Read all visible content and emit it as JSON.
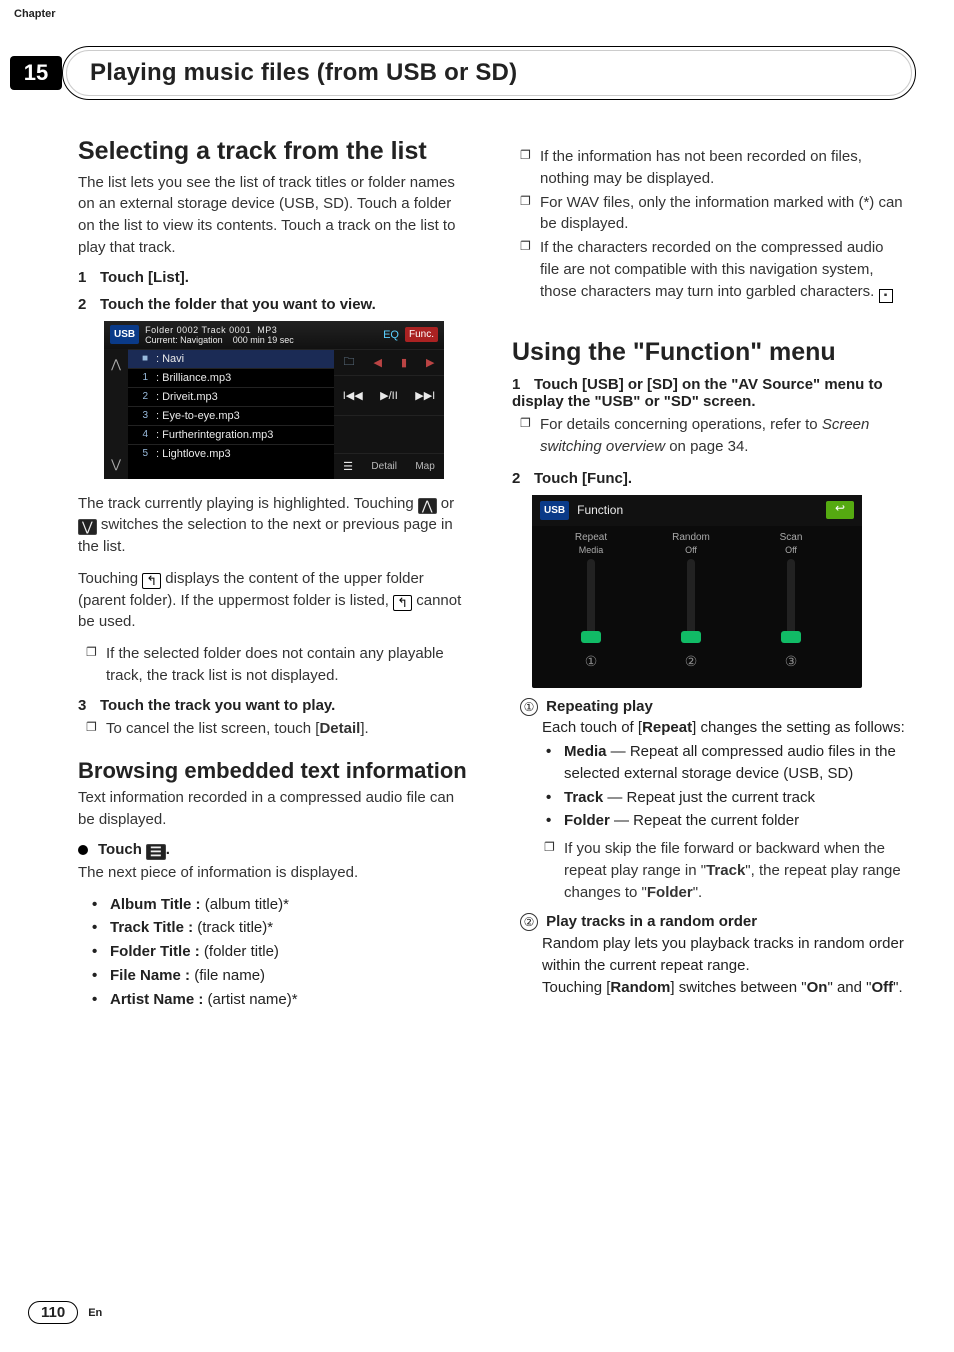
{
  "header": {
    "chapter_label": "Chapter",
    "chapter_number": "15",
    "title": "Playing music files (from USB or SD)"
  },
  "left": {
    "sec1_title": "Selecting a track from the list",
    "sec1_intro": "The list lets you see the list of track titles or folder names on an external storage device (USB, SD). Touch a folder on the list to view its contents. Touch a track on the list to play that track.",
    "step1": "Touch [List].",
    "step2": "Touch the folder that you want to view.",
    "shot1": {
      "badge": "USB",
      "folder_track": "Folder 0002  Track 0001",
      "fmt": "MP3",
      "current_row": "Current: Navigation",
      "time": "000 min 19 sec",
      "eq": "EQ",
      "func": "Func.",
      "rows": [
        {
          "idx": "",
          "label": ": Navi",
          "sel": true,
          "is_folder": true
        },
        {
          "idx": "1",
          "label": ": Brilliance.mp3"
        },
        {
          "idx": "2",
          "label": ": Driveit.mp3"
        },
        {
          "idx": "3",
          "label": ": Eye-to-eye.mp3"
        },
        {
          "idx": "4",
          "label": ": Furtherintegration.mp3"
        },
        {
          "idx": "5",
          "label": ": Lightlove.mp3"
        }
      ],
      "right_labels": {
        "detail": "Detail",
        "map": "Map"
      }
    },
    "after_shot_p1": "The track currently playing is highlighted. Touching ",
    "after_shot_p1b": " or ",
    "after_shot_p1c": " switches the selection to the next or previous page in the list.",
    "after_shot_p2a": "Touching ",
    "after_shot_p2b": " displays the content of the upper folder (parent folder). If the uppermost folder is listed, ",
    "after_shot_p2c": " cannot be used.",
    "note_no_playable": "If the selected folder does not contain any playable track, the track list is not displayed.",
    "step3": "Touch the track you want to play.",
    "step3_note": "To cancel the list screen, touch [",
    "step3_note_b": "Detail",
    "step3_note_c": "].",
    "sec2_title": "Browsing embedded text information",
    "sec2_intro": "Text information recorded in a compressed audio file can be displayed.",
    "touch_menu": "Touch ",
    "touch_menu_after": ".",
    "next_piece": "The next piece of information is displayed.",
    "fields": [
      {
        "k": "Album Title :",
        "v": " (album title)*"
      },
      {
        "k": "Track Title :",
        "v": " (track title)*"
      },
      {
        "k": "Folder Title :",
        "v": " (folder title)"
      },
      {
        "k": "File Name :",
        "v": " (file name)"
      },
      {
        "k": "Artist Name :",
        "v": " (artist name)*"
      }
    ]
  },
  "right": {
    "notes": [
      "If the information has not been recorded on files, nothing may be displayed.",
      "For WAV files, only the information marked with (*) can be displayed.",
      "If the characters recorded on the compressed audio file are not compatible with this navigation system, those characters may turn into garbled characters."
    ],
    "sec_title_a": "Using the \"",
    "sec_title_b": "Function",
    "sec_title_c": "\" menu",
    "step1": "Touch [USB] or [SD] on the \"AV Source\" menu to display the \"USB\" or \"SD\" screen.",
    "step1_detail_a": "For details concerning operations, refer to ",
    "step1_detail_b": "Screen switching overview",
    "step1_detail_c": " on page 34.",
    "step2": "Touch [Func].",
    "shot2": {
      "badge": "USB",
      "title": "Function",
      "sliders": [
        {
          "label": "Repeat",
          "value": "Media"
        },
        {
          "label": "Random",
          "value": "Off"
        },
        {
          "label": "Scan",
          "value": "Off"
        }
      ],
      "marks": [
        "①",
        "②",
        "③"
      ]
    },
    "defs": [
      {
        "num": "①",
        "head": "Repeating play",
        "body_a": "Each touch of [",
        "body_b": "Repeat",
        "body_c": "] changes the setting as follows:",
        "opts": [
          {
            "k": "Media",
            "v": " — Repeat all compressed audio files in the selected external storage device (USB, SD)"
          },
          {
            "k": "Track",
            "v": " — Repeat just the current track"
          },
          {
            "k": "Folder",
            "v": " — Repeat the current folder"
          }
        ],
        "note_a": "If you skip the file forward or backward when the repeat play range in \"",
        "note_b": "Track",
        "note_c": "\", the repeat play range changes to \"",
        "note_d": "Folder",
        "note_e": "\"."
      },
      {
        "num": "②",
        "head": "Play tracks in a random order",
        "body": "Random play lets you playback tracks in random order within the current repeat range.",
        "body2_a": "Touching [",
        "body2_b": "Random",
        "body2_c": "] switches between \"",
        "body2_d": "On",
        "body2_e": "\" and \"",
        "body2_f": "Off",
        "body2_g": "\"."
      }
    ]
  },
  "footer": {
    "page": "110",
    "lang": "En"
  }
}
